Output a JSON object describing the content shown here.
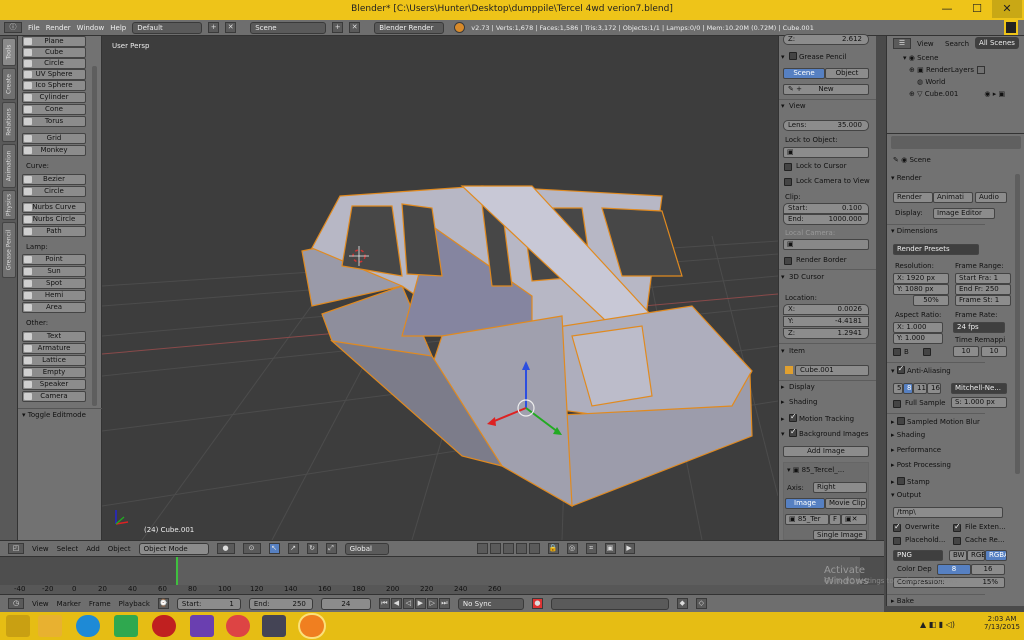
{
  "window": {
    "title": "Blender* [C:\\Users\\Hunter\\Desktop\\dumppile\\Tercel 4wd verion7.blend]",
    "min": "—",
    "max": "☐",
    "close": "✕"
  },
  "infobar": {
    "menus": [
      "File",
      "Render",
      "Window",
      "Help"
    ],
    "layout": "Default",
    "scene": "Scene",
    "engine": "Blender Render",
    "stats": "v2.73 | Verts:1,678 | Faces:1,586 | Tris:3,172 | Objects:1/1 | Lamps:0/0 | Mem:10.20M (0.72M) | Cube.001"
  },
  "tabs": [
    "Tools",
    "Create",
    "Relations",
    "Animation",
    "Physics",
    "Grease Pencil"
  ],
  "toolbox": {
    "mesh": [
      "Plane",
      "Cube",
      "Circle",
      "UV Sphere",
      "Ico Sphere",
      "Cylinder",
      "Cone",
      "Torus"
    ],
    "mesh2": [
      "Grid",
      "Monkey"
    ],
    "curve_label": "Curve:",
    "curve": [
      "Bezier",
      "Circle"
    ],
    "curve2": [
      "Nurbs Curve",
      "Nurbs Circle",
      "Path"
    ],
    "lamp_label": "Lamp:",
    "lamp": [
      "Point",
      "Sun",
      "Spot",
      "Hemi",
      "Area"
    ],
    "other_label": "Other:",
    "other": [
      "Text",
      "Armature",
      "Lattice",
      "Empty",
      "Speaker",
      "Camera"
    ],
    "toggle": "Toggle Editmode"
  },
  "viewport": {
    "label": "User Persp",
    "object": "(24) Cube.001"
  },
  "npanel": {
    "z_top": {
      "label": "Z:",
      "value": "2.612"
    },
    "grease_pencil": "Grease Pencil",
    "gp_scene": "Scene",
    "gp_object": "Object",
    "gp_new": "New",
    "view": "View",
    "lens_label": "Lens:",
    "lens": "35.000",
    "lock_to_object": "Lock to Object:",
    "lock_to_cursor": "Lock to Cursor",
    "lock_camera": "Lock Camera to View",
    "clip": "Clip:",
    "clip_start_label": "Start:",
    "clip_start": "0.100",
    "clip_end_label": "End:",
    "clip_end": "1000.000",
    "local_camera": "Local Camera:",
    "render_border": "Render Border",
    "cursor3d": "3D Cursor",
    "location": "Location:",
    "loc": [
      {
        "label": "X:",
        "value": "0.0026"
      },
      {
        "label": "Y:",
        "value": "-4.4181"
      },
      {
        "label": "Z:",
        "value": "1.2941"
      }
    ],
    "item": "Item",
    "item_name": "Cube.001",
    "display": "Display",
    "shading": "Shading",
    "motion_tracking": "Motion Tracking",
    "background_images": "Background Images",
    "add_image": "Add Image",
    "bg_name": "85_Tercel_...",
    "axis_label": "Axis:",
    "axis": "Right",
    "image": "Image",
    "movie_clip": "Movie Clip",
    "bg_file": "85_Ter",
    "source": "Single Image"
  },
  "outliner": {
    "view": "View",
    "search": "Search",
    "all_scenes": "All Scenes",
    "items": [
      "Scene",
      "RenderLayers",
      "World",
      "Cube.001"
    ]
  },
  "props": {
    "scene": "Scene",
    "render": "Render",
    "render_btn": "Render",
    "anim_btn": "Animati",
    "audio_btn": "Audio",
    "display_label": "Display:",
    "display": "Image Editor",
    "dimensions": "Dimensions",
    "presets": "Render Presets",
    "resolution": "Resolution:",
    "res_x": "X: 1920 px",
    "res_y": "Y: 1080 px",
    "res_pct": "50%",
    "frame_range": "Frame Range:",
    "start_frame": "Start Fra: 1",
    "end_frame": "End Fr: 250",
    "frame_step": "Frame St: 1",
    "aspect": "Aspect Ratio:",
    "asp_x": "X:    1.000",
    "asp_y": "Y:    1.000",
    "frame_rate": "Frame Rate:",
    "fps": "24 fps",
    "time_remap": "Time Remappi",
    "remap_old": "10",
    "remap_new": "10",
    "b_label": "B",
    "antialiasing": "Anti-Aliasing",
    "aa": [
      "5",
      "8",
      "11",
      "16"
    ],
    "aa_filter": "Mitchell-Ne...",
    "full_sample": "Full Sample",
    "filter_size": "S: 1.000 px",
    "sampled_mb": "Sampled Motion Blur",
    "shading": "Shading",
    "performance": "Performance",
    "post_processing": "Post Processing",
    "stamp": "Stamp",
    "output": "Output",
    "path": "/tmp\\",
    "overwrite": "Overwrite",
    "file_ext": "File Exten...",
    "placeholders": "Placehold...",
    "cache_result": "Cache Re...",
    "format": "PNG",
    "bw": "BW",
    "rgb": "RGB",
    "rgba": "RGBA",
    "color_depth": "Color Dep",
    "cd8": "8",
    "cd16": "16",
    "compression_label": "Compression:",
    "compression": "15%",
    "bake": "Bake"
  },
  "vheader": {
    "menus": [
      "View",
      "Select",
      "Add",
      "Object"
    ],
    "mode": "Object Mode",
    "orientation": "Global"
  },
  "timeline": {
    "ticks": [
      "-40",
      "-20",
      "0",
      "20",
      "40",
      "60",
      "80",
      "100",
      "120",
      "140",
      "160",
      "180",
      "200",
      "220",
      "240",
      "260"
    ],
    "current_frame": 24,
    "menus": [
      "View",
      "Marker",
      "Frame",
      "Playback"
    ],
    "start": "Start:",
    "start_val": "1",
    "end": "End:",
    "end_val": "250",
    "frame": "24",
    "sync": "No Sync"
  },
  "activation": {
    "line1": "Activate Windows",
    "line2": "Go to PC settings to activate Windows."
  },
  "taskbar": {
    "time": "2:03 AM",
    "date": "7/13/2015"
  },
  "colors": {
    "title": "#eec419",
    "panel": "#727272",
    "viewport": "#3d3d3d",
    "accent": "#5680c2",
    "taskbar": "#e6bd14"
  }
}
